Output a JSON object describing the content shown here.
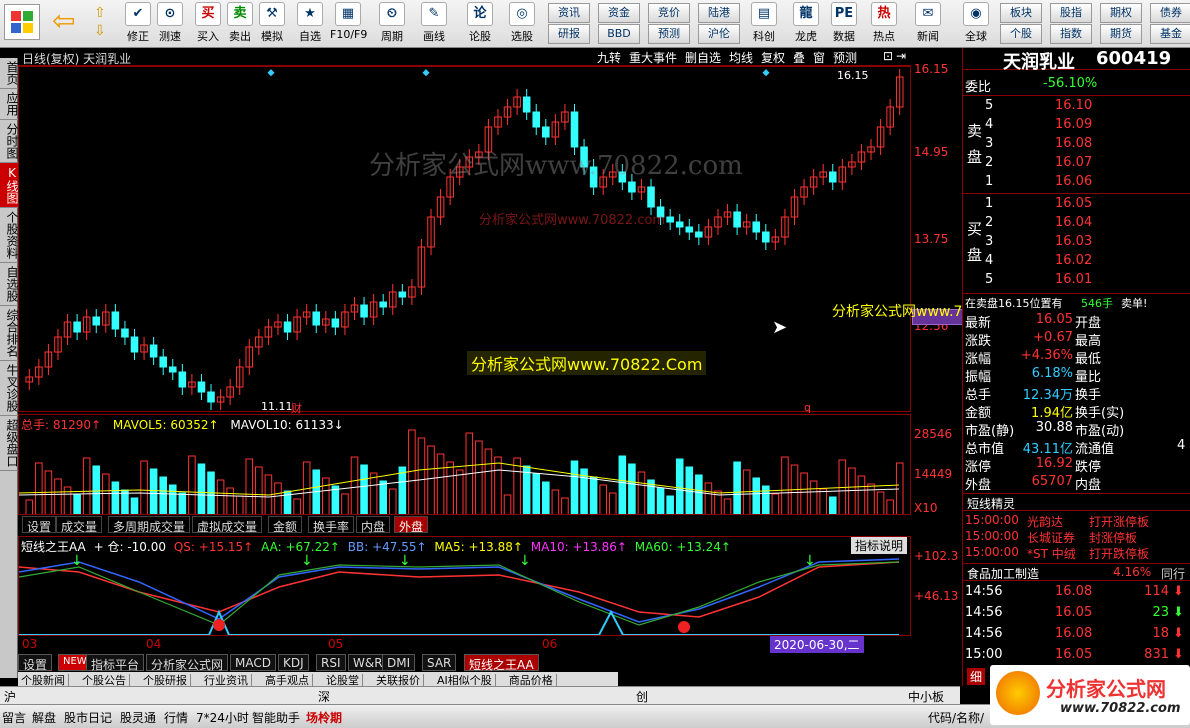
{
  "toolbar": {
    "items": [
      "修正",
      "测速",
      "买入",
      "卖出",
      "模拟",
      "自选",
      "F10/F9",
      "周期",
      "画线",
      "论股",
      "选股",
      "科创",
      "龙虎",
      "数据",
      "热点",
      "新闻",
      "全球"
    ],
    "small": [
      "资讯",
      "资金",
      "竞价",
      "陆港",
      "研报",
      "BBD",
      "预测",
      "沪伦",
      "板块",
      "股指",
      "期权",
      "债券",
      "个股",
      "指数",
      "期货",
      "基金"
    ]
  },
  "left_tabs": [
    "首页",
    "应用",
    "分时图",
    "K线图",
    "个股资料",
    "自选股",
    "综合排名",
    "牛叉诊股",
    "超级盘口"
  ],
  "chart_header": {
    "title": "日线(复权)  天润乳业",
    "buttons": [
      "九转",
      "重大事件",
      "删自选",
      "均线",
      "复权",
      "叠",
      "窗",
      "预测"
    ]
  },
  "price_axis": [
    "16.15",
    "14.95",
    "13.75",
    "12.56"
  ],
  "chart_annotations": {
    "high_label": "16.15",
    "low_label": "11.11",
    "low_flag": "财",
    "q_label": "q"
  },
  "volume": {
    "label_total": "总手: 81290↑",
    "label_ma5": "MAVOL5: 60352↑",
    "label_ma10": "MAVOL10: 61133↓",
    "axis": [
      "28546",
      "14449",
      "X10"
    ]
  },
  "volume_tabs": [
    "设置",
    "成交量",
    "多周期成交量",
    "虚拟成交量",
    "金额",
    "换手率",
    "内盘",
    "外盘"
  ],
  "indicator": {
    "name": "短线之王AA",
    "cang": "+ 仓: -10.00",
    "qs": "QS: +15.15↑",
    "aa": "AA: +67.22↑",
    "bb": "BB: +47.55↑",
    "ma5": "MA5: +13.88↑",
    "ma10": "MA10: +13.86↑",
    "ma60": "MA60: +13.24↑",
    "help": "指标说明",
    "axis": [
      "+102.3",
      "+46.13"
    ]
  },
  "date_axis": [
    "03",
    "04",
    "05",
    "06"
  ],
  "cursor_date": "2020-06-30,二",
  "bottom_tabs": [
    "设置",
    "NEW",
    "指标平台",
    "分析家公式网",
    "MACD",
    "KDJ",
    "RSI",
    "W&R",
    "DMI",
    "SAR",
    "短线之王AA"
  ],
  "news_tabs": [
    "个股新闻",
    "个股公告",
    "个股研报",
    "行业资讯",
    "高手观点",
    "论股堂",
    "关联报价",
    "AI相似个股",
    "商品价格"
  ],
  "market_bar": [
    "沪",
    "深",
    "创",
    "中小板"
  ],
  "status_bar": [
    "留言",
    "解盘",
    "股市日记",
    "股灵通",
    "行情",
    "7*24小时",
    "智能助手",
    "场柃期",
    "代码/名称/"
  ],
  "watermarks": [
    "分析家公式网www.70822.com",
    "分析家公式网www.70822.Com"
  ],
  "stock": {
    "name": "天润乳业",
    "code": "600419"
  },
  "order_book": {
    "weibi_label": "委比",
    "weibi": "-56.10%",
    "sell_label": "卖盘",
    "sell": [
      [
        "5",
        "16.10"
      ],
      [
        "4",
        "16.09"
      ],
      [
        "3",
        "16.08"
      ],
      [
        "2",
        "16.07"
      ],
      [
        "1",
        "16.06"
      ]
    ],
    "buy_label": "买盘",
    "buy": [
      [
        "1",
        "16.05"
      ],
      [
        "2",
        "16.04"
      ],
      [
        "3",
        "16.03"
      ],
      [
        "4",
        "16.02"
      ],
      [
        "5",
        "16.01"
      ]
    ]
  },
  "ticker_line": {
    "text": "在卖盘16.15位置有",
    "vol": "546手",
    "tail": "卖单!"
  },
  "quote": [
    [
      "最新",
      "16.05",
      "开盘",
      ""
    ],
    [
      "涨跌",
      "+0.67",
      "最高",
      ""
    ],
    [
      "涨幅",
      "+4.36%",
      "最低",
      ""
    ],
    [
      "振幅",
      "6.18%",
      "量比",
      ""
    ],
    [
      "总手",
      "12.34万",
      "换手",
      ""
    ],
    [
      "金额",
      "1.94亿",
      "换手(实)",
      ""
    ],
    [
      "市盈(静)",
      "30.88",
      "市盈(动)",
      ""
    ],
    [
      "总市值",
      "43.11亿",
      "流通值",
      "4"
    ],
    [
      "涨停",
      "16.92",
      "跌停",
      ""
    ],
    [
      "外盘",
      "65707",
      "内盘",
      ""
    ]
  ],
  "elite": {
    "title": "短线精灵",
    "rows": [
      [
        "15:00:00",
        "光韵达",
        "打开涨停板"
      ],
      [
        "15:00:00",
        "长城证券",
        "封涨停板"
      ],
      [
        "15:00:00",
        "*ST 中绒",
        "打开跌停板"
      ]
    ]
  },
  "sector": {
    "name": "食品加工制造",
    "pct": "4.16%",
    "tab": "同行"
  },
  "ticks": [
    [
      "14:56",
      "16.08",
      "114",
      "down"
    ],
    [
      "14:56",
      "16.05",
      "23",
      "down"
    ],
    [
      "14:56",
      "16.08",
      "18",
      "down"
    ],
    [
      "15:00",
      "16.05",
      "831",
      "down"
    ]
  ],
  "tick_tab": "细",
  "logo_text": "分析家公式网",
  "logo_url": "www.70822.com",
  "colors": {
    "up": "#ff3333",
    "down": "#33ffff",
    "ma5": "#ffffff",
    "ma10": "#ffff00"
  }
}
